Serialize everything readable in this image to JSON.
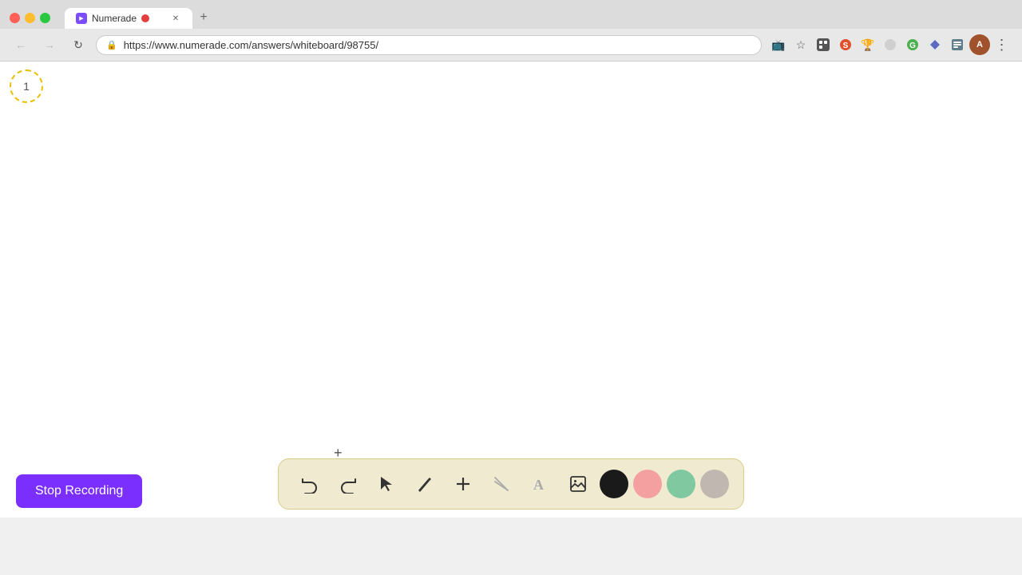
{
  "browser": {
    "tab": {
      "title": "Numerade",
      "favicon_label": "numerade-favicon",
      "close_label": "✕"
    },
    "new_tab_label": "+",
    "nav": {
      "back_label": "←",
      "forward_label": "→",
      "reload_label": "↻",
      "url": "https://www.numerade.com/answers/whiteboard/98755/",
      "lock_icon": "🔒"
    }
  },
  "whiteboard": {
    "page_number": "1",
    "cursor_symbol": "+"
  },
  "toolbar": {
    "undo_label": "↺",
    "redo_label": "↻",
    "select_label": "▲",
    "pen_label": "✏",
    "add_label": "+",
    "eraser_label": "✂",
    "text_label": "A",
    "image_label": "🖼",
    "colors": [
      {
        "name": "black",
        "class": "color-black"
      },
      {
        "name": "pink",
        "class": "color-pink"
      },
      {
        "name": "green",
        "class": "color-green"
      },
      {
        "name": "gray",
        "class": "color-gray"
      }
    ]
  },
  "stop_recording": {
    "label": "Stop Recording"
  }
}
